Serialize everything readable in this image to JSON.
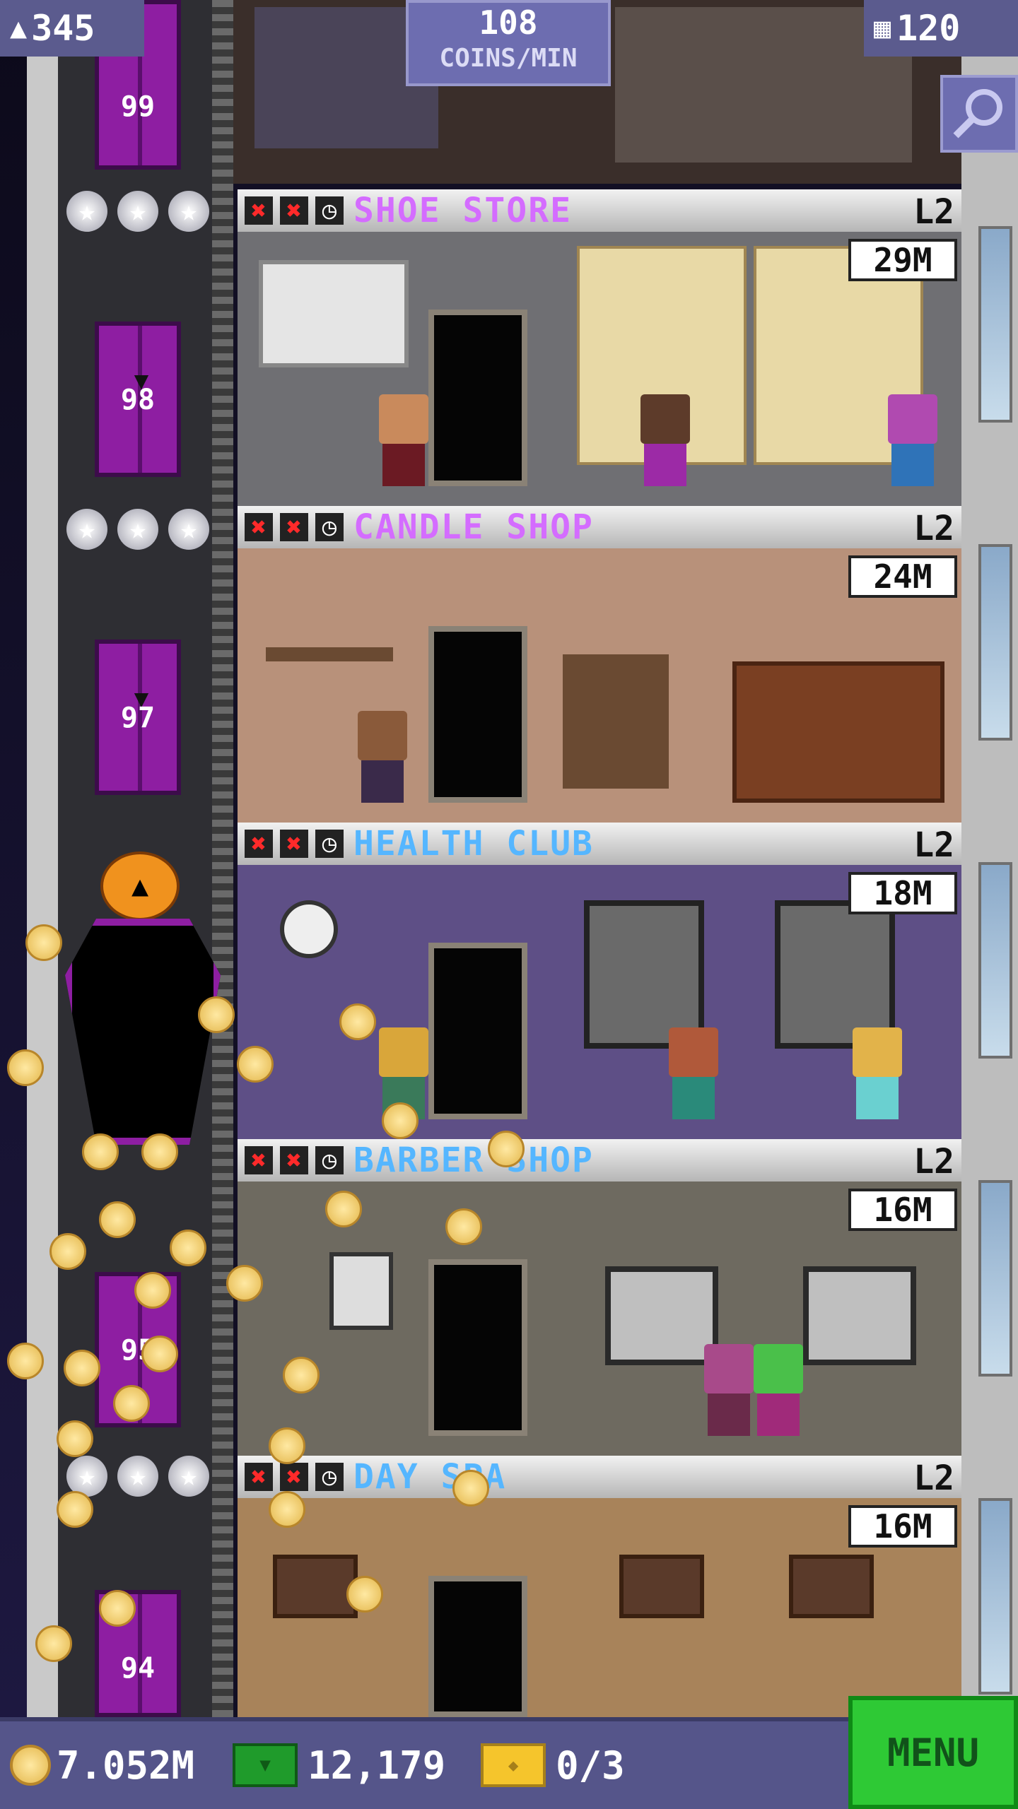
{
  "hud": {
    "residents": "345",
    "coins_per_min_value": "108",
    "coins_per_min_unit": "COINS/MIN",
    "floor_count": "120"
  },
  "floors": [
    {
      "name": "SHOE STORE",
      "level": "L2",
      "income": "29M",
      "name_color": "#d46cff",
      "elevator_number": "98"
    },
    {
      "name": "CANDLE SHOP",
      "level": "L2",
      "income": "24M",
      "name_color": "#d46cff",
      "elevator_number": "97"
    },
    {
      "name": "HEALTH CLUB",
      "level": "L2",
      "income": "18M",
      "name_color": "#55b6ff",
      "elevator_number": ""
    },
    {
      "name": "BARBER SHOP",
      "level": "L2",
      "income": "16M",
      "name_color": "#55b6ff",
      "elevator_number": "95"
    },
    {
      "name": "DAY SPA",
      "level": "L2",
      "income": "16M",
      "name_color": "#55b6ff",
      "elevator_number": "94"
    }
  ],
  "top_elevator_number": "99",
  "bottom_bar": {
    "coins": "7.052M",
    "bux": "12,179",
    "tickets": "0/3",
    "menu_label": "MENU"
  },
  "icons": {
    "residents": "person-icon",
    "floors": "building-icon",
    "search": "magnifier-icon",
    "status_fail": "x-icon",
    "timer": "clock-icon",
    "coins": "coin-icon",
    "bux": "bux-icon",
    "tickets": "ticket-icon"
  }
}
